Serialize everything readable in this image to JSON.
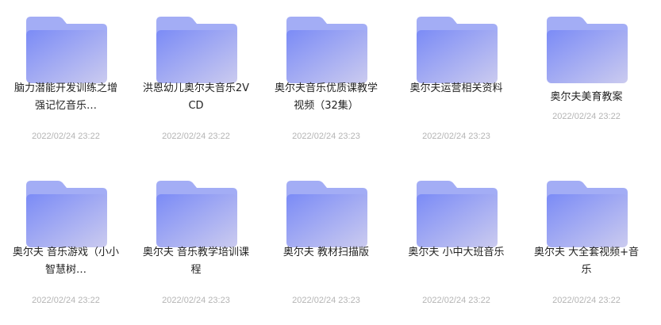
{
  "files": [
    {
      "name": "脑力潜能开发训练之增强记忆音乐…",
      "date": "2022/02/24 23:22"
    },
    {
      "name": "洪恩幼儿奥尔夫音乐2VCD",
      "date": "2022/02/24 23:22"
    },
    {
      "name": "奥尔夫音乐优质课教学视频（32集）",
      "date": "2022/02/24 23:23"
    },
    {
      "name": "奥尔夫运营相关资料",
      "date": "2022/02/24 23:23"
    },
    {
      "name": "奥尔夫美育教案",
      "date": "2022/02/24 23:22"
    },
    {
      "name": "奥尔夫 音乐游戏（小小智慧树…",
      "date": "2022/02/24 23:22"
    },
    {
      "name": "奥尔夫 音乐教学培训课程",
      "date": "2022/02/24 23:23"
    },
    {
      "name": "奥尔夫 教材扫描版",
      "date": "2022/02/24 23:23"
    },
    {
      "name": "奥尔夫 小中大班音乐",
      "date": "2022/02/24 23:22"
    },
    {
      "name": "奥尔夫 大全套视频+音乐",
      "date": "2022/02/24 23:22"
    }
  ],
  "icon": "folder-icon",
  "colors": {
    "folder_back": "#9aa6f5",
    "folder_front_start": "#7f8ef6",
    "folder_front_end": "#c7c9ef",
    "name_text": "#222222",
    "date_text": "#b4b4b4"
  }
}
